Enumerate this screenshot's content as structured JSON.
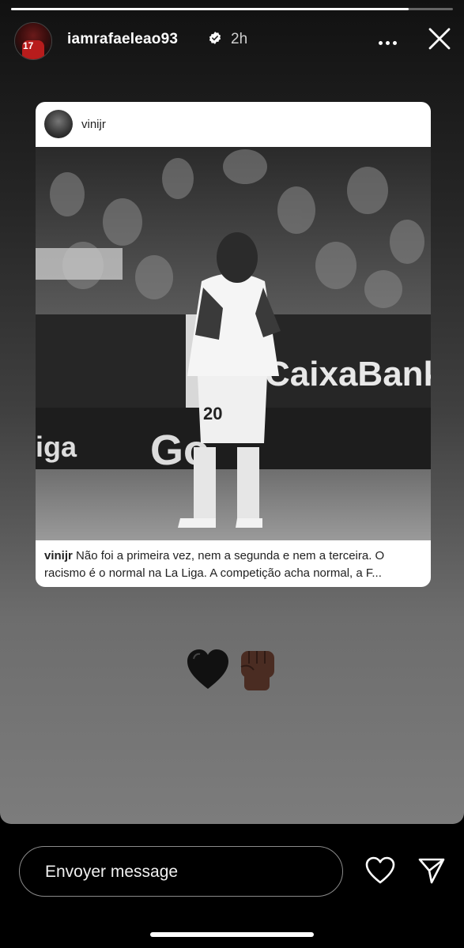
{
  "story": {
    "username": "iamrafaeleao93",
    "time": "2h",
    "verified": true,
    "progress": 0.9
  },
  "shared_post": {
    "username": "vinijr",
    "caption_user": "vinijr",
    "caption_line1": "Não foi a primeira vez, nem a segunda e nem a terceira. O",
    "caption_line2": "racismo é o normal na La Liga.  A competição acha normal, a F...",
    "photo_texts": {
      "sponsor": "CaixaBank",
      "shirt_number": "20",
      "board_partial": "Go",
      "board_left": "iga"
    }
  },
  "sticker": {
    "emojis": [
      "black-heart",
      "raised-fist-dark-skin"
    ]
  },
  "reply": {
    "placeholder": "Envoyer message"
  },
  "icons": {
    "more": "more-horizontal-icon",
    "close": "close-icon",
    "like": "heart-outline-icon",
    "send": "paper-plane-icon",
    "verified": "verified-badge-icon"
  }
}
